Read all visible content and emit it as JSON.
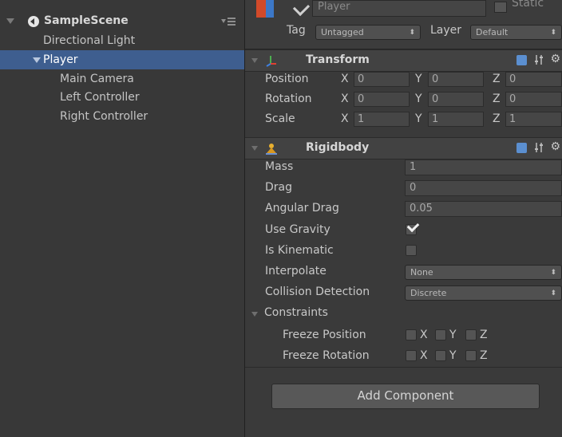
{
  "hierarchy": {
    "scene_name": "SampleScene",
    "items": [
      {
        "label": "Directional Light"
      },
      {
        "label": "Player"
      },
      {
        "label": "Main Camera"
      },
      {
        "label": "Left Controller"
      },
      {
        "label": "Right Controller"
      }
    ]
  },
  "inspector": {
    "object_name": "Player",
    "static_label": "Static",
    "tag_label": "Tag",
    "tag_value": "Untagged",
    "layer_label": "Layer",
    "layer_value": "Default",
    "transform": {
      "title": "Transform",
      "position_label": "Position",
      "rotation_label": "Rotation",
      "scale_label": "Scale",
      "axis_x": "X",
      "axis_y": "Y",
      "axis_z": "Z",
      "position": [
        "0",
        "0",
        "0"
      ],
      "rotation": [
        "0",
        "0",
        "0"
      ],
      "scale": [
        "1",
        "1",
        "1"
      ]
    },
    "rigidbody": {
      "title": "Rigidbody",
      "mass_label": "Mass",
      "mass": "1",
      "drag_label": "Drag",
      "drag": "0",
      "angular_drag_label": "Angular Drag",
      "angular_drag": "0.05",
      "use_gravity_label": "Use Gravity",
      "use_gravity": true,
      "is_kinematic_label": "Is Kinematic",
      "is_kinematic": false,
      "interpolate_label": "Interpolate",
      "interpolate": "None",
      "collision_label": "Collision Detection",
      "collision": "Discrete",
      "constraints_label": "Constraints",
      "freeze_position_label": "Freeze Position",
      "freeze_rotation_label": "Freeze Rotation",
      "axis_x": "X",
      "axis_y": "Y",
      "axis_z": "Z"
    },
    "add_component_label": "Add Component"
  },
  "colors": {
    "panel_bg": "#383838",
    "selection": "#3e5e8f",
    "text": "#c8c8c8"
  }
}
